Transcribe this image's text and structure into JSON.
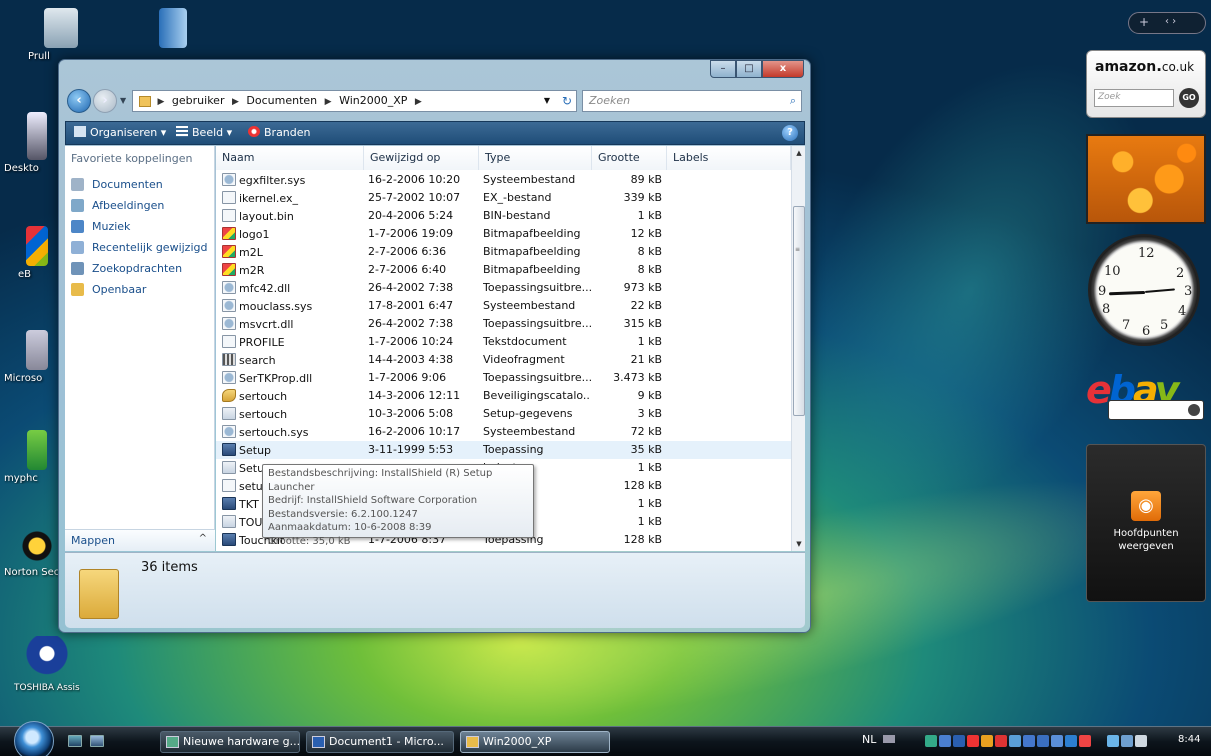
{
  "desktop": {
    "icons": [
      {
        "label": "Prull"
      },
      {
        "label": "Deskto"
      },
      {
        "label": "eB"
      },
      {
        "label": "Microso"
      },
      {
        "label": "myphc"
      },
      {
        "label": "Norton Sec"
      },
      {
        "label": "TOSHIBA Assist"
      }
    ]
  },
  "sidebar": {
    "top_plus": "+",
    "top_arrows": "‹  ›",
    "amazon": {
      "brand": "amazon",
      "suffix": "co.uk",
      "placeholder": "Zoek",
      "go": "GO"
    },
    "clock": {
      "numerals": [
        "12",
        "2",
        "3",
        "4",
        "5",
        "6",
        "7",
        "8",
        "9",
        "10"
      ]
    },
    "ebay": {
      "letters": [
        "e",
        "b",
        "a",
        "y"
      ]
    },
    "feed": {
      "line1": "Hoofdpunten",
      "line2": "weergeven"
    }
  },
  "window": {
    "caption": {
      "minimize": "–",
      "maximize": "□",
      "close": "x"
    },
    "breadcrumb": [
      "gebruiker",
      "Documenten",
      "Win2000_XP"
    ],
    "search_placeholder": "Zoeken",
    "toolbar": {
      "organize": "Organiseren",
      "view": "Beeld",
      "burn": "Branden",
      "help": "?"
    },
    "nav": {
      "header": "Favoriete koppelingen",
      "items": [
        "Documenten",
        "Afbeeldingen",
        "Muziek",
        "Recentelijk gewijzigd",
        "Zoekopdrachten",
        "Openbaar"
      ],
      "mappen": "Mappen"
    },
    "columns": {
      "name": "Naam",
      "date": "Gewijzigd op",
      "type": "Type",
      "size": "Grootte",
      "labels": "Labels"
    },
    "files": [
      {
        "name": "egxfilter.sys",
        "date": "16-2-2006 10:20",
        "type": "Systeembestand",
        "size": "89 kB",
        "icon": "sys"
      },
      {
        "name": "ikernel.ex_",
        "date": "25-7-2002 10:07",
        "type": "EX_-bestand",
        "size": "339 kB",
        "icon": "doc"
      },
      {
        "name": "layout.bin",
        "date": "20-4-2006 5:24",
        "type": "BIN-bestand",
        "size": "1 kB",
        "icon": "doc"
      },
      {
        "name": "logo1",
        "date": "1-7-2006 19:09",
        "type": "Bitmapafbeelding",
        "size": "12 kB",
        "icon": "bmp"
      },
      {
        "name": "m2L",
        "date": "2-7-2006 6:36",
        "type": "Bitmapafbeelding",
        "size": "8 kB",
        "icon": "bmp"
      },
      {
        "name": "m2R",
        "date": "2-7-2006 6:40",
        "type": "Bitmapafbeelding",
        "size": "8 kB",
        "icon": "bmp"
      },
      {
        "name": "mfc42.dll",
        "date": "26-4-2002 7:38",
        "type": "Toepassingsuitbre...",
        "size": "973 kB",
        "icon": "sys"
      },
      {
        "name": "mouclass.sys",
        "date": "17-8-2001 6:47",
        "type": "Systeembestand",
        "size": "22 kB",
        "icon": "sys"
      },
      {
        "name": "msvcrt.dll",
        "date": "26-4-2002 7:38",
        "type": "Toepassingsuitbre...",
        "size": "315 kB",
        "icon": "sys"
      },
      {
        "name": "PROFILE",
        "date": "1-7-2006 10:24",
        "type": "Tekstdocument",
        "size": "1 kB",
        "icon": "doc"
      },
      {
        "name": "search",
        "date": "14-4-2003 4:38",
        "type": "Videofragment",
        "size": "21 kB",
        "icon": "vid"
      },
      {
        "name": "SerTKProp.dll",
        "date": "1-7-2006 9:06",
        "type": "Toepassingsuitbre...",
        "size": "3.473 kB",
        "icon": "sys"
      },
      {
        "name": "sertouch",
        "date": "14-3-2006 12:11",
        "type": "Beveiligingscatalo...",
        "size": "9 kB",
        "icon": "cat"
      },
      {
        "name": "sertouch",
        "date": "10-3-2006 5:08",
        "type": "Setup-gegevens",
        "size": "3 kB",
        "icon": "inf"
      },
      {
        "name": "sertouch.sys",
        "date": "16-2-2006 10:17",
        "type": "Systeembestand",
        "size": "72 kB",
        "icon": "sys"
      },
      {
        "name": "Setup",
        "date": "3-11-1999 5:53",
        "type": "Toepassing",
        "size": "35 kB",
        "icon": "exe"
      },
      {
        "name": "Setu",
        "date": "",
        "type": "ie-inste...",
        "size": "1 kB",
        "icon": "inf"
      },
      {
        "name": "setu",
        "date": "",
        "type": "d",
        "size": "128 kB",
        "icon": "doc"
      },
      {
        "name": "TKT",
        "date": "",
        "type": "",
        "size": "1 kB",
        "icon": "exe"
      },
      {
        "name": "TOU",
        "date": "",
        "type": "ie-inste...",
        "size": "1 kB",
        "icon": "inf"
      },
      {
        "name": "Touchkit",
        "date": "1-7-2006 8:37",
        "type": "Toepassing",
        "size": "128 kB",
        "icon": "exe"
      }
    ],
    "tooltip": [
      "Bestandsbeschrijving: InstallShield (R) Setup Launcher",
      "Bedrijf: InstallShield Software Corporation",
      "Bestandsversie: 6.2.100.1247",
      "Aanmaakdatum: 10-6-2008 8:39",
      "Grootte: 35,0 kB"
    ],
    "item_count": "36 items"
  },
  "taskbar": {
    "buttons": [
      "Nieuwe hardware g...",
      "Document1 - Micro...",
      "Win2000_XP"
    ],
    "language": "NL",
    "time": "8:44"
  },
  "colors": {
    "accent": "#1a4f8b",
    "toolbar": "#2a5a86",
    "highlight": "#e5f1fb"
  }
}
